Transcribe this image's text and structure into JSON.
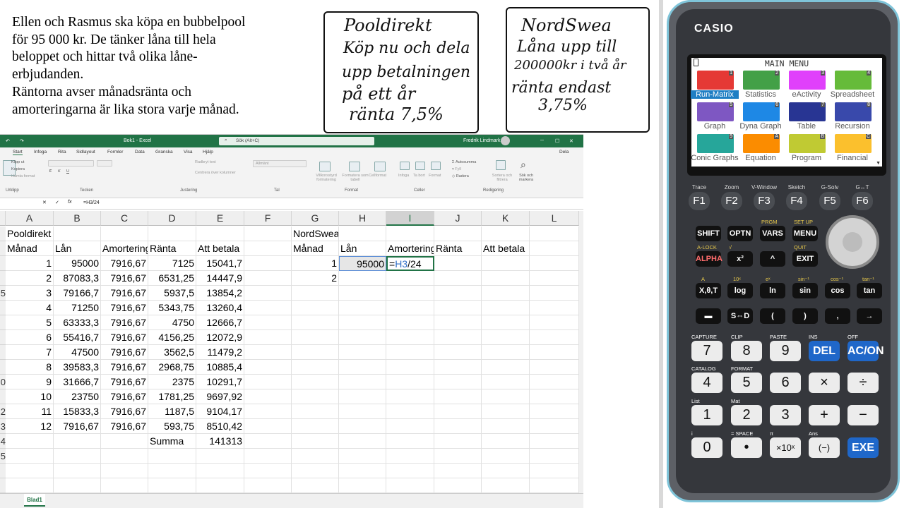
{
  "problem": {
    "lines": [
      "Ellen och Rasmus ska köpa en bubbelpool",
      "för 95 000 kr. De tänker låna till hela",
      "beloppet och hittar två olika låne-",
      "erbjudanden.",
      "Räntorna avser månadsränta och",
      "amorteringarna är lika stora varje månad."
    ]
  },
  "note1": {
    "lines": [
      "Pooldirekt",
      "Köp nu och dela",
      "upp betalningen",
      "på ett år",
      "ränta 7,5%"
    ]
  },
  "note2": {
    "lines": [
      "NordSwea",
      "Låna upp till",
      "200000kr i två år",
      "ränta endast",
      "3,75%"
    ]
  },
  "excel": {
    "title": "Bok1 - Excel",
    "user": "Fredrik Lindmark",
    "search": "Sök (Alt+C)",
    "share": "Dela",
    "tabs": [
      "Arkiv",
      "Start",
      "Infoga",
      "Rita",
      "Sidlayout",
      "Formler",
      "Data",
      "Granska",
      "Visa",
      "Hjälp"
    ],
    "ribbon": {
      "groups": [
        "Urklipp",
        "Tecken",
        "Justering",
        "Tal",
        "Format",
        "Celler",
        "Redigering"
      ],
      "clip_cut": "Klipp ut",
      "clip_copy": "Kopiera",
      "clip_format": "Hämta format",
      "wrap": "Radbryt text",
      "merge": "Centrera över kolumner",
      "number_format": "Allmänt",
      "cond_format": "Villkorsstyrd formatering",
      "table_format": "Formatera som tabell",
      "cell_style": "Cellformat",
      "insert": "Infoga",
      "delete": "Ta bort",
      "format": "Format",
      "autosum": "Autosumma",
      "fill": "Fyll",
      "clear": "Radera",
      "sort": "Sortera och filtrera",
      "find": "Sök och markera"
    },
    "name_box": "",
    "formula": "=H3/24",
    "columns": [
      "A",
      "B",
      "C",
      "D",
      "E",
      "F",
      "G",
      "H",
      "I",
      "J",
      "K",
      "L"
    ],
    "active_column": "I",
    "left_table": {
      "title": "Pooldirekt",
      "headers": [
        "Månad",
        "Lån",
        "Amortering",
        "Ränta",
        "Att betala"
      ],
      "rows": [
        [
          "1",
          "95000",
          "7916,67",
          "7125",
          "15041,7"
        ],
        [
          "2",
          "87083,3",
          "7916,67",
          "6531,25",
          "14447,9"
        ],
        [
          "3",
          "79166,7",
          "7916,67",
          "5937,5",
          "13854,2"
        ],
        [
          "4",
          "71250",
          "7916,67",
          "5343,75",
          "13260,4"
        ],
        [
          "5",
          "63333,3",
          "7916,67",
          "4750",
          "12666,7"
        ],
        [
          "6",
          "55416,7",
          "7916,67",
          "4156,25",
          "12072,9"
        ],
        [
          "7",
          "47500",
          "7916,67",
          "3562,5",
          "11479,2"
        ],
        [
          "8",
          "39583,3",
          "7916,67",
          "2968,75",
          "10885,4"
        ],
        [
          "9",
          "31666,7",
          "7916,67",
          "2375",
          "10291,7"
        ],
        [
          "10",
          "23750",
          "7916,67",
          "1781,25",
          "9697,92"
        ],
        [
          "11",
          "15833,3",
          "7916,67",
          "1187,5",
          "9104,17"
        ],
        [
          "12",
          "7916,67",
          "7916,67",
          "593,75",
          "8510,42"
        ]
      ],
      "sum_label": "Summa",
      "sum_value": "141313"
    },
    "right_table": {
      "title": "NordSwea",
      "headers": [
        "Månad",
        "Lån",
        "Amortering",
        "Ränta",
        "Att betala"
      ],
      "row1": [
        "1",
        "95000"
      ],
      "row2": [
        "2"
      ],
      "editing_prefix": "=",
      "editing_ref": "H3",
      "editing_suffix": "/24"
    },
    "row_numbers": [
      "",
      "",
      "",
      "",
      "5",
      "",
      "",
      "",
      "",
      "",
      "0",
      "",
      "2",
      "3",
      "4",
      "5",
      "",
      "",
      ""
    ],
    "sheet": "Blad1"
  },
  "calculator": {
    "brand": "CASIO",
    "menu_title": "MAIN MENU",
    "apps": [
      {
        "name": "Run-Matrix",
        "no": "1",
        "color": "#e53935"
      },
      {
        "name": "Statistics",
        "no": "2",
        "color": "#43a047"
      },
      {
        "name": "eActivity",
        "no": "3",
        "color": "#e040fb"
      },
      {
        "name": "Spreadsheet",
        "no": "4",
        "color": "#66bb3a"
      },
      {
        "name": "Graph",
        "no": "5",
        "color": "#7e57c2"
      },
      {
        "name": "Dyna Graph",
        "no": "6",
        "color": "#1e88e5"
      },
      {
        "name": "Table",
        "no": "7",
        "color": "#283593"
      },
      {
        "name": "Recursion",
        "no": "8",
        "color": "#3949ab"
      },
      {
        "name": "Conic Graphs",
        "no": "9",
        "color": "#26a69a"
      },
      {
        "name": "Equation",
        "no": "A",
        "color": "#fb8c00"
      },
      {
        "name": "Program",
        "no": "B",
        "color": "#c0ca33"
      },
      {
        "name": "Financial",
        "no": "C",
        "color": "#fbc02d"
      }
    ],
    "fkeys": [
      "F1",
      "F2",
      "F3",
      "F4",
      "F5",
      "F6"
    ],
    "flabels": [
      "Trace",
      "Zoom",
      "V-Window",
      "Sketch",
      "G-Solv",
      "G↔T"
    ],
    "row1": [
      "SHIFT",
      "OPTN",
      "VARS",
      "MENU"
    ],
    "row1_labels": [
      "",
      "",
      "PRGM",
      "SET UP"
    ],
    "row2": [
      "ALPHA",
      "x²",
      "^",
      "EXIT"
    ],
    "row2_labels": [
      "A-LOCK",
      "√",
      "",
      "QUIT"
    ],
    "row3": [
      "X,θ,T",
      "log",
      "ln",
      "sin",
      "cos",
      "tan"
    ],
    "row3_labels": [
      "A",
      "10ˣ",
      "eˣ",
      "sin⁻¹",
      "cos⁻¹",
      "tan⁻¹"
    ],
    "row4": [
      "▬",
      "S⇔D",
      "(",
      ")",
      ",",
      "→"
    ],
    "num1": [
      "7",
      "8",
      "9",
      "DEL",
      "AC/ON"
    ],
    "num1_labels": [
      "CAPTURE",
      "CLIP",
      "PASTE",
      "INS",
      "OFF"
    ],
    "num2": [
      "4",
      "5",
      "6",
      "×",
      "÷"
    ],
    "num2_labels": [
      "CATALOG",
      "FORMAT",
      "",
      "",
      ""
    ],
    "num3": [
      "1",
      "2",
      "3",
      "+",
      "−"
    ],
    "num3_labels": [
      "List",
      "Mat",
      "",
      "",
      ""
    ],
    "num4": [
      "0",
      "•",
      "×10ˣ",
      "(−)",
      "EXE"
    ],
    "num4_labels": [
      "i",
      "= SPACE",
      "π",
      "Ans",
      ""
    ]
  }
}
